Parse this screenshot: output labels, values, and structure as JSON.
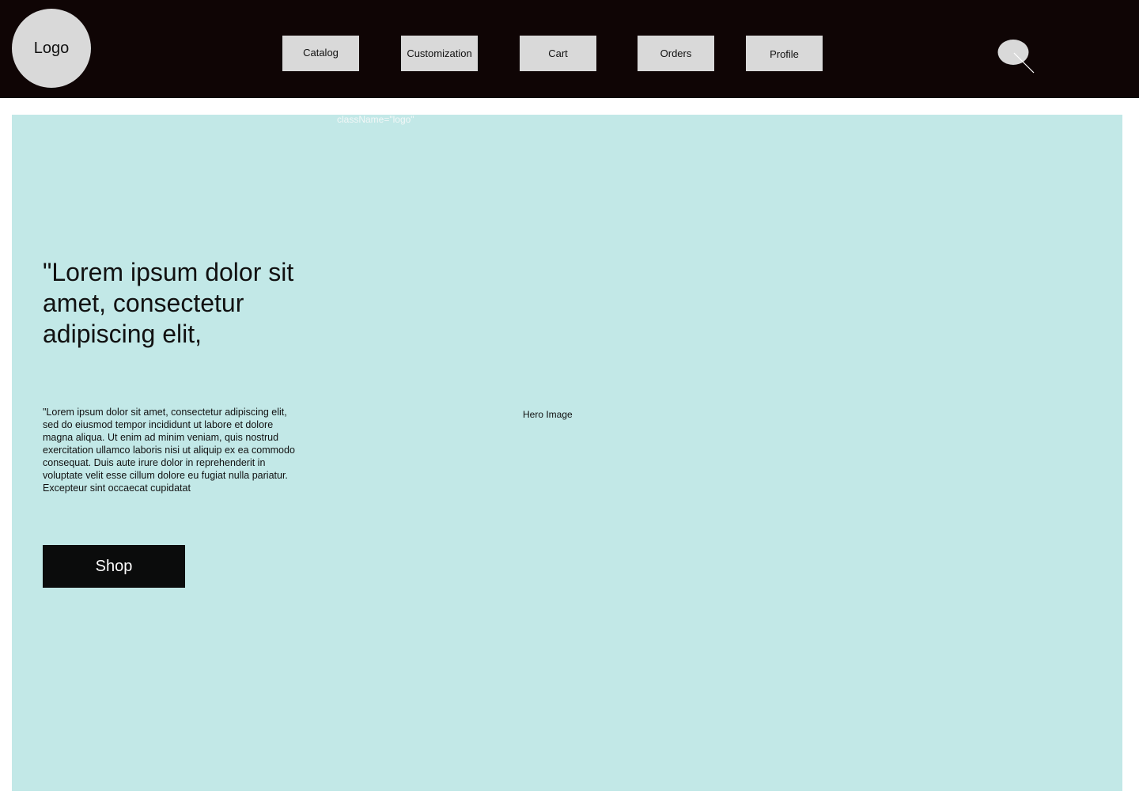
{
  "header": {
    "logo_label": "Logo",
    "nav": {
      "catalog": "Catalog",
      "customization": "Customization",
      "cart": "Cart",
      "orders": "Orders",
      "profile": "Profile"
    },
    "search_icon": "search-icon"
  },
  "annotation": "className=\"logo\"",
  "hero": {
    "headline": "\"Lorem ipsum dolor sit amet, consectetur adipiscing elit,",
    "body": "\"Lorem ipsum dolor sit amet, consectetur adipiscing elit, sed do eiusmod tempor incididunt ut labore et dolore magna aliqua. Ut enim ad minim veniam, quis nostrud exercitation ullamco laboris nisi ut aliquip ex ea commodo consequat. Duis aute irure dolor in reprehenderit in voluptate velit esse cillum dolore eu fugiat nulla pariatur. Excepteur sint occaecat cupidatat",
    "shop_label": "Shop",
    "image_label": "Hero Image"
  },
  "colors": {
    "header_bg": "#0f0505",
    "hero_bg": "#c2e8e7",
    "nav_button_bg": "#d9d9d9",
    "shop_button_bg": "#0b0c0c"
  }
}
